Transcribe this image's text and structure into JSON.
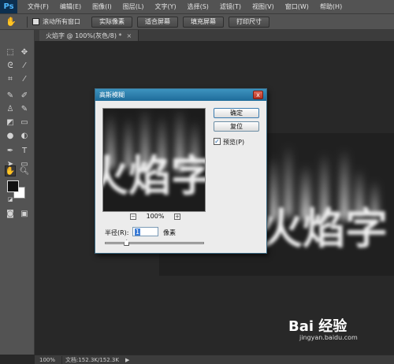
{
  "app": {
    "logo": "Ps"
  },
  "menubar": {
    "items": [
      "文件(F)",
      "编辑(E)",
      "图像(I)",
      "图层(L)",
      "文字(Y)",
      "选择(S)",
      "滤镜(T)",
      "视图(V)",
      "窗口(W)",
      "帮助(H)"
    ]
  },
  "options_bar": {
    "tool_icon": "hand-tool-icon",
    "checkbox_label": "滚动所有窗口",
    "checkbox_checked": false,
    "buttons": [
      "实际像素",
      "适合屏幕",
      "填充屏幕",
      "打印尺寸"
    ]
  },
  "document": {
    "tab_title": "火焰字 @ 100%(灰色/8) *",
    "close": "×",
    "canvas_text": "火焰字",
    "preview_text": "火焰字"
  },
  "status": {
    "zoom": "100%",
    "doc_info": "文档:152.3K/152.3K",
    "arrow": "▶"
  },
  "dialog": {
    "title": "高斯模糊",
    "close": "x",
    "ok_label": "确定",
    "reset_label": "复位",
    "preview_label": "预览(P)",
    "preview_checked": true,
    "preview_check_glyph": "✓",
    "zoom_minus": "−",
    "zoom_plus": "+",
    "zoom_level": "100%",
    "radius_label": "半径(R):",
    "radius_value": "1",
    "radius_unit": "像素",
    "slider_position": 0.22
  },
  "colors": {
    "foreground": "#111111",
    "background": "#ffffff",
    "accent": "#1f6c9a"
  },
  "watermark": {
    "logo": "Bai 经验",
    "url": "jingyan.baidu.com"
  }
}
